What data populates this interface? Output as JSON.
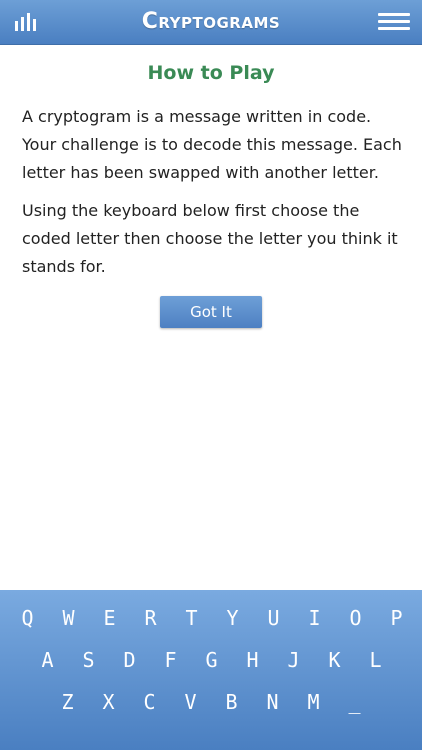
{
  "header": {
    "stats_icon": "bar-chart-icon",
    "title": "Cryptograms",
    "menu_icon": "hamburger-menu-icon"
  },
  "content": {
    "heading": "How to Play",
    "paragraph_1": "A cryptogram is a message written in code. Your challenge is to decode this message. Each letter has been swapped with another letter.",
    "paragraph_2": "Using the keyboard below first choose the coded letter then choose the letter you think it stands for.",
    "button_label": "Got It"
  },
  "keyboard": {
    "rows": [
      [
        "Q",
        "W",
        "E",
        "R",
        "T",
        "Y",
        "U",
        "I",
        "O",
        "P"
      ],
      [
        "A",
        "S",
        "D",
        "F",
        "G",
        "H",
        "J",
        "K",
        "L"
      ],
      [
        "Z",
        "X",
        "C",
        "V",
        "B",
        "N",
        "M",
        "_"
      ]
    ]
  },
  "colors": {
    "header_blue": "#5a8ccb",
    "heading_green": "#3a8a55",
    "keyboard_blue": "#6196d3",
    "button_blue": "#5b8ccb"
  }
}
